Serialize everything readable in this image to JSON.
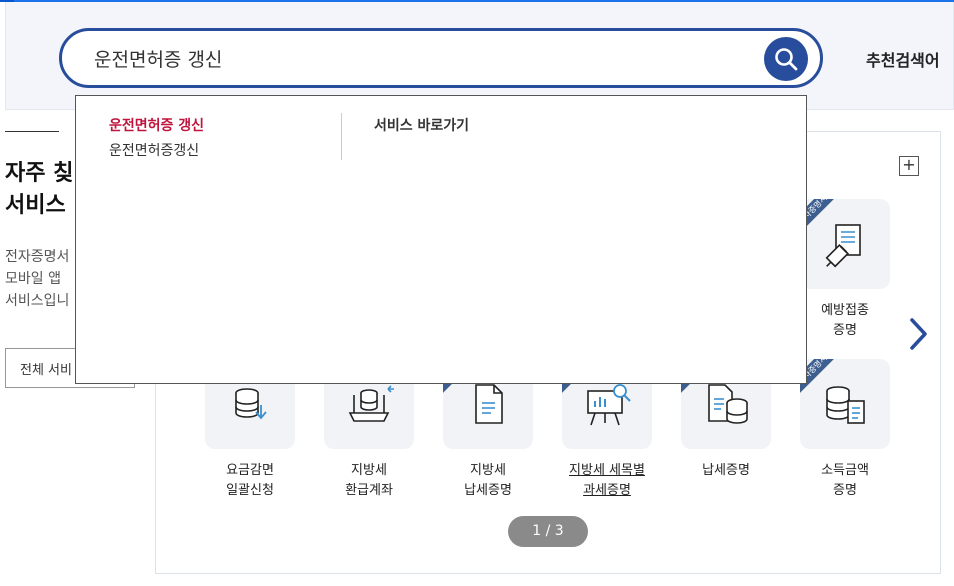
{
  "search": {
    "query": "운전면허증 갱신",
    "button_icon": "search-icon"
  },
  "header": {
    "recommend_label": "추천검색어"
  },
  "autocomplete": {
    "items": [
      "운전면허증 갱신",
      "운전면허증갱신"
    ],
    "shortcut_title": "서비스 바로가기"
  },
  "left_panel": {
    "title": "자주 칮\n서비스",
    "description": "전자증명서\n모바일 앱\n서비스입니",
    "all_services_label": "전체 서비"
  },
  "services_panel": {
    "plus_label": "+",
    "next_icon": "chevron-right-icon",
    "pager": "1 / 3",
    "ribbon_text": "전자증명서",
    "top_item": {
      "label": "예방접종\n증명",
      "icon": "vaccine-document-icon",
      "ribbon": true
    },
    "items": [
      {
        "label": "요금감면\n일괄신청",
        "icon": "database-down-icon",
        "ribbon": false,
        "underline": false
      },
      {
        "label": "지방세\n환급계좌",
        "icon": "database-laptop-icon",
        "ribbon": false,
        "underline": false
      },
      {
        "label": "지방세\n납세증명",
        "icon": "document-icon",
        "ribbon": true,
        "underline": false
      },
      {
        "label": "지방세 세목별\n과세증명",
        "icon": "presentation-chart-icon",
        "ribbon": true,
        "underline": true
      },
      {
        "label": "납세증명",
        "icon": "document-database-icon",
        "ribbon": true,
        "underline": false
      },
      {
        "label": "소득금액\n증명",
        "icon": "database-document-icon",
        "ribbon": true,
        "underline": false
      }
    ]
  },
  "colors": {
    "accent": "#274d9c",
    "highlight": "#c0143c",
    "ribbon": "#3d5f8f"
  }
}
